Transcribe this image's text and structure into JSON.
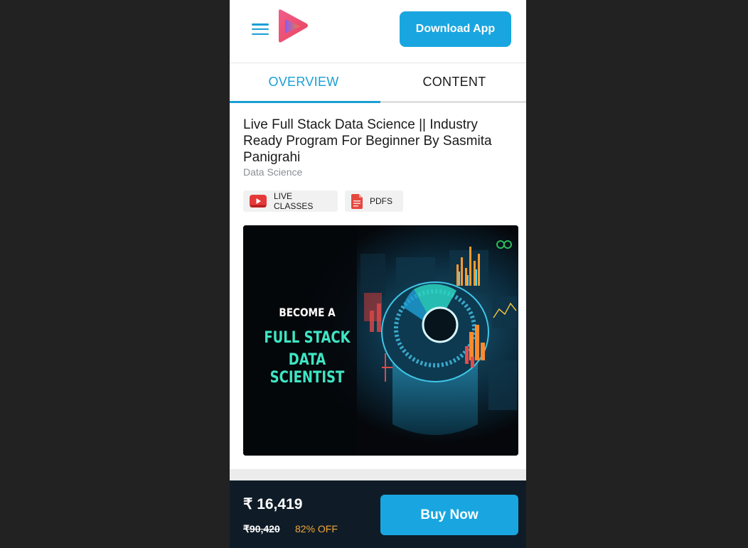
{
  "header": {
    "download_label": "Download App"
  },
  "tabs": [
    {
      "label": "OVERVIEW",
      "active": true
    },
    {
      "label": "CONTENT",
      "active": false
    }
  ],
  "course": {
    "title": "Live Full Stack Data Science || Industry Ready Program For Beginner By Sasmita Panigrahi",
    "category": "Data Science",
    "features": [
      {
        "label": "LIVE CLASSES",
        "icon": "youtube-play-icon"
      },
      {
        "label": "PDFS",
        "icon": "pdf-file-icon"
      }
    ],
    "banner": {
      "line1": "BECOME A",
      "line2": "FULL STACK",
      "line3": "DATA SCIENTIST"
    }
  },
  "pricing": {
    "price": "₹ 16,419",
    "original_price": "₹90,420",
    "discount": "82% OFF",
    "buy_label": "Buy Now"
  },
  "colors": {
    "accent": "#1a9fd6",
    "button": "#19a6e0",
    "footer": "#0f1c27",
    "discount": "#f0a73a",
    "banner_teal": "#3ee6c4"
  }
}
